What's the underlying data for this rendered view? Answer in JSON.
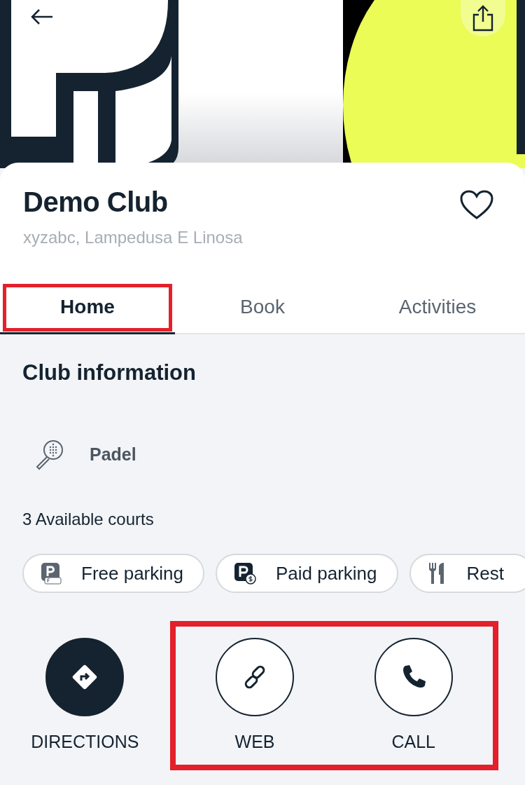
{
  "club": {
    "name": "Demo Club",
    "address": "xyzabc, Lampedusa E Linosa",
    "favorite": false
  },
  "tabs": [
    {
      "label": "Home",
      "selected": true,
      "highlighted": true
    },
    {
      "label": "Book",
      "selected": false,
      "highlighted": false
    },
    {
      "label": "Activities",
      "selected": false,
      "highlighted": false
    }
  ],
  "section_title": "Club information",
  "sport": "Padel",
  "courts": "3 Available courts",
  "amenities": [
    {
      "kind": "free-parking",
      "label": "Free parking"
    },
    {
      "kind": "paid-parking",
      "label": "Paid parking"
    },
    {
      "kind": "restaurant",
      "label": "Rest"
    }
  ],
  "action_groups": [
    {
      "highlighted": false,
      "actions": [
        {
          "kind": "directions",
          "label": "DIRECTIONS",
          "filled": true
        }
      ]
    },
    {
      "highlighted": true,
      "actions": [
        {
          "kind": "web",
          "label": "WEB",
          "filled": false
        },
        {
          "kind": "call",
          "label": "CALL",
          "filled": false
        }
      ]
    }
  ]
}
